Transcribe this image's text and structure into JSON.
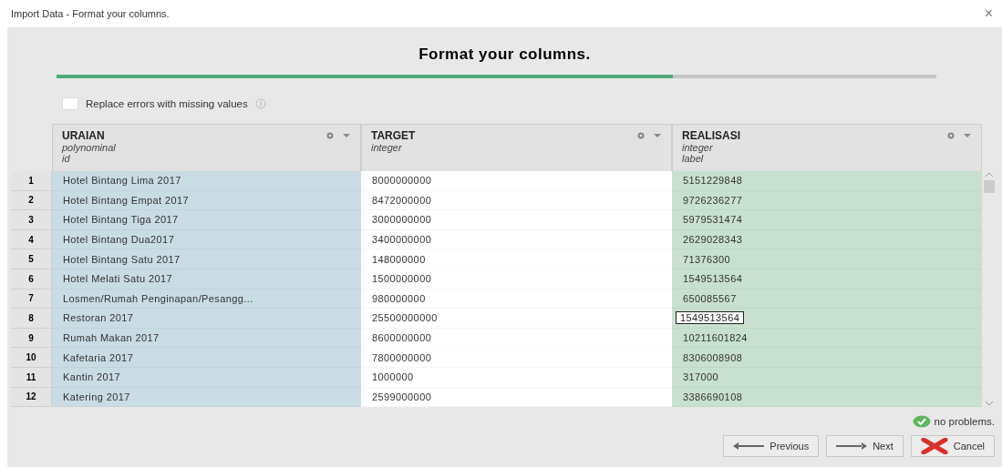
{
  "window": {
    "title": "Import Data - Format your columns.",
    "close": "×"
  },
  "heading": "Format your columns.",
  "progress": {
    "level": 0.7
  },
  "replace_errors": {
    "label": "Replace errors with missing values",
    "checked": false
  },
  "table": {
    "columns": [
      {
        "name": "URAIAN",
        "type": "polynominal",
        "role": "id",
        "kind": "id"
      },
      {
        "name": "TARGET",
        "type": "integer",
        "kind": "regular"
      },
      {
        "name": "REALISASI",
        "type": "integer",
        "role": "label",
        "kind": "label"
      }
    ],
    "rows": [
      {
        "index": "1",
        "cells": [
          "Hotel Bintang Lima 2017",
          "8000000000",
          "5151229848"
        ]
      },
      {
        "index": "2",
        "cells": [
          "Hotel Bintang Empat 2017",
          "8472000000",
          "9726236277"
        ]
      },
      {
        "index": "3",
        "cells": [
          "Hotel Bintang Tiga 2017",
          "3000000000",
          "5979531474"
        ]
      },
      {
        "index": "4",
        "cells": [
          "Hotel Bintang Dua2017",
          "3400000000",
          "2629028343"
        ]
      },
      {
        "index": "5",
        "cells": [
          "Hotel Bintang Satu 2017",
          "148000000",
          "71376300"
        ]
      },
      {
        "index": "6",
        "cells": [
          "Hotel Melati Satu 2017",
          "1500000000",
          "1549513564"
        ]
      },
      {
        "index": "7",
        "cells": [
          "Losmen/Rumah Penginapan/Pesangg...",
          "980000000",
          "650085567"
        ]
      },
      {
        "index": "8",
        "cells": [
          "Restoran 2017",
          "25500000000",
          ""
        ],
        "editor": {
          "value": "1549513564"
        }
      },
      {
        "index": "9",
        "cells": [
          "Rumah Makan 2017",
          "8600000000",
          "10211601824"
        ]
      },
      {
        "index": "10",
        "cells": [
          "Kafetaria 2017",
          "7800000000",
          "8306008908"
        ]
      },
      {
        "index": "11",
        "cells": [
          "Kantin 2017",
          "1000000",
          "317000"
        ]
      },
      {
        "index": "12",
        "cells": [
          "Katering 2017",
          "2599000000",
          "3386690108"
        ]
      }
    ]
  },
  "status": "no problems.",
  "buttons": [
    {
      "label": "Previous",
      "kind": "previous"
    },
    {
      "label": "Next",
      "kind": "next"
    },
    {
      "label": "Cancel",
      "kind": "cancel"
    }
  ]
}
